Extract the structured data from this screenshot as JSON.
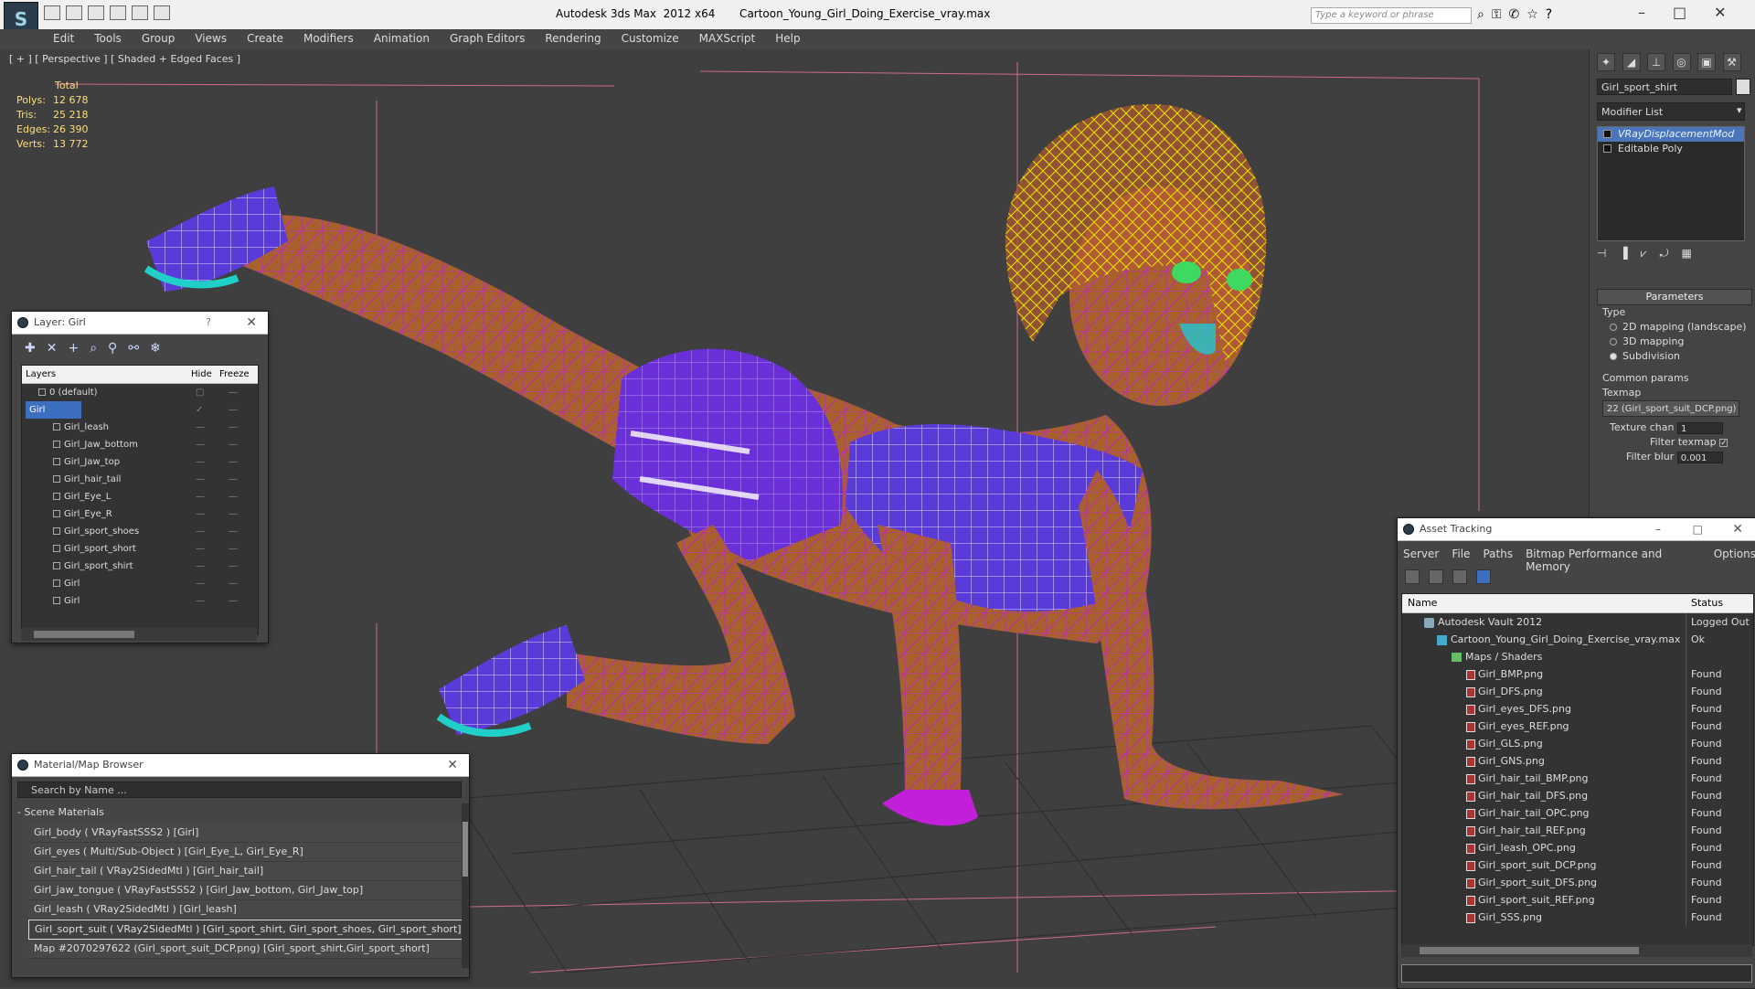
{
  "titlebar": {
    "title": "Autodesk 3ds Max  2012 x64       Cartoon_Young_Girl_Doing_Exercise_vray.max",
    "search_placeholder": "Type a keyword or phrase",
    "logo": "3ds-max-logo"
  },
  "menu": [
    "Edit",
    "Tools",
    "Group",
    "Views",
    "Create",
    "Modifiers",
    "Animation",
    "Graph Editors",
    "Rendering",
    "Customize",
    "MAXScript",
    "Help"
  ],
  "viewport": {
    "label": "[ + ] [ Perspective ] [ Shaded + Edged Faces ]",
    "stats": {
      "header": "Total",
      "rows": [
        {
          "label": "Polys:",
          "value": "12 678"
        },
        {
          "label": "Tris:",
          "value": "25 218"
        },
        {
          "label": "Edges:",
          "value": "26 390"
        },
        {
          "label": "Verts:",
          "value": "13 772"
        }
      ]
    }
  },
  "command_panel": {
    "object_name": "Girl_sport_shirt",
    "modifier_list_label": "Modifier List",
    "stack": [
      {
        "label": "VRayDisplacementMod",
        "selected": true
      },
      {
        "label": "Editable Poly",
        "selected": false
      }
    ],
    "rollout_title": "Parameters",
    "type_label": "Type",
    "type_options": [
      {
        "label": "2D mapping (landscape)",
        "selected": false
      },
      {
        "label": "3D mapping",
        "selected": false
      },
      {
        "label": "Subdivision",
        "selected": true
      }
    ],
    "common_params_label": "Common params",
    "texmap_label": "Texmap",
    "texmap_value": "22 (Girl_sport_suit_DCP.png)",
    "texture_chan_label": "Texture chan",
    "texture_chan_value": "1",
    "filter_texmap_label": "Filter texmap",
    "filter_texmap_check": "✓",
    "filter_blur_label": "Filter blur",
    "filter_blur_value": "0.001"
  },
  "layer_dialog": {
    "title": "Layer: Girl",
    "help": "?",
    "columns": {
      "layers": "Layers",
      "hide": "Hide",
      "freeze": "Freeze"
    },
    "rows": [
      {
        "name": "0 (default)",
        "indent": 0,
        "selected": false
      },
      {
        "name": "Girl",
        "indent": 0,
        "selected": true
      },
      {
        "name": "Girl_leash",
        "indent": 1,
        "selected": false
      },
      {
        "name": "Girl_Jaw_bottom",
        "indent": 1,
        "selected": false
      },
      {
        "name": "Girl_Jaw_top",
        "indent": 1,
        "selected": false
      },
      {
        "name": "Girl_hair_tail",
        "indent": 1,
        "selected": false
      },
      {
        "name": "Girl_Eye_L",
        "indent": 1,
        "selected": false
      },
      {
        "name": "Girl_Eye_R",
        "indent": 1,
        "selected": false
      },
      {
        "name": "Girl_sport_shoes",
        "indent": 1,
        "selected": false
      },
      {
        "name": "Girl_sport_short",
        "indent": 1,
        "selected": false
      },
      {
        "name": "Girl_sport_shirt",
        "indent": 1,
        "selected": false
      },
      {
        "name": "Girl",
        "indent": 1,
        "selected": false
      },
      {
        "name": "Girl",
        "indent": 1,
        "selected": false
      }
    ]
  },
  "material_browser": {
    "title": "Material/Map Browser",
    "search_placeholder": "Search by Name ...",
    "section": "- Scene Materials",
    "items": [
      {
        "label": "Girl_body  ( VRayFastSSS2 )  [Girl]",
        "selected": false
      },
      {
        "label": "Girl_eyes  ( Multi/Sub-Object )  [Girl_Eye_L, Girl_Eye_R]",
        "selected": false
      },
      {
        "label": "Girl_hair_tail  ( VRay2SidedMtl )  [Girl_hair_tail]",
        "selected": false
      },
      {
        "label": "Girl_jaw_tongue  ( VRayFastSSS2 )  [Girl_Jaw_bottom, Girl_Jaw_top]",
        "selected": false
      },
      {
        "label": "Girl_leash  ( VRay2SidedMtl )  [Girl_leash]",
        "selected": false
      },
      {
        "label": "Girl_soprt_suit  ( VRay2SidedMtl )  [Girl_sport_shirt, Girl_sport_shoes, Girl_sport_short]",
        "selected": true
      },
      {
        "label": "Map #2070297622 (Girl_sport_suit_DCP.png)  [Girl_sport_shirt,Girl_sport_short]",
        "selected": false
      }
    ]
  },
  "asset_tracking": {
    "title": "Asset Tracking",
    "menu": [
      "Server",
      "File",
      "Paths",
      "Bitmap Performance and Memory",
      "Options"
    ],
    "columns": {
      "name": "Name",
      "status": "Status"
    },
    "rows": [
      {
        "name": "Autodesk Vault 2012",
        "status": "Logged Out",
        "indent": 1,
        "icon": "vault"
      },
      {
        "name": "Cartoon_Young_Girl_Doing_Exercise_vray.max",
        "status": "Ok",
        "indent": 2,
        "icon": "file"
      },
      {
        "name": "Maps / Shaders",
        "status": "",
        "indent": 3,
        "icon": "folder"
      },
      {
        "name": "Girl_BMP.png",
        "status": "Found",
        "indent": 4,
        "icon": "png"
      },
      {
        "name": "Girl_DFS.png",
        "status": "Found",
        "indent": 4,
        "icon": "png"
      },
      {
        "name": "Girl_eyes_DFS.png",
        "status": "Found",
        "indent": 4,
        "icon": "png"
      },
      {
        "name": "Girl_eyes_REF.png",
        "status": "Found",
        "indent": 4,
        "icon": "png"
      },
      {
        "name": "Girl_GLS.png",
        "status": "Found",
        "indent": 4,
        "icon": "png"
      },
      {
        "name": "Girl_GNS.png",
        "status": "Found",
        "indent": 4,
        "icon": "png"
      },
      {
        "name": "Girl_hair_tail_BMP.png",
        "status": "Found",
        "indent": 4,
        "icon": "png"
      },
      {
        "name": "Girl_hair_tail_DFS.png",
        "status": "Found",
        "indent": 4,
        "icon": "png"
      },
      {
        "name": "Girl_hair_tail_OPC.png",
        "status": "Found",
        "indent": 4,
        "icon": "png"
      },
      {
        "name": "Girl_hair_tail_REF.png",
        "status": "Found",
        "indent": 4,
        "icon": "png"
      },
      {
        "name": "Girl_leash_OPC.png",
        "status": "Found",
        "indent": 4,
        "icon": "png"
      },
      {
        "name": "Girl_sport_suit_DCP.png",
        "status": "Found",
        "indent": 4,
        "icon": "png"
      },
      {
        "name": "Girl_sport_suit_DFS.png",
        "status": "Found",
        "indent": 4,
        "icon": "png"
      },
      {
        "name": "Girl_sport_suit_REF.png",
        "status": "Found",
        "indent": 4,
        "icon": "png"
      },
      {
        "name": "Girl_SSS.png",
        "status": "Found",
        "indent": 4,
        "icon": "png"
      }
    ]
  },
  "colors": {
    "accent_blue": "#3d6fc0",
    "viewport_bg": "#3f3f3f",
    "stats_yellow": "#ffde7a",
    "wire_purple": "#c21fd8",
    "skin": "#a8602f",
    "suit_purple": "#6a2fd8"
  }
}
